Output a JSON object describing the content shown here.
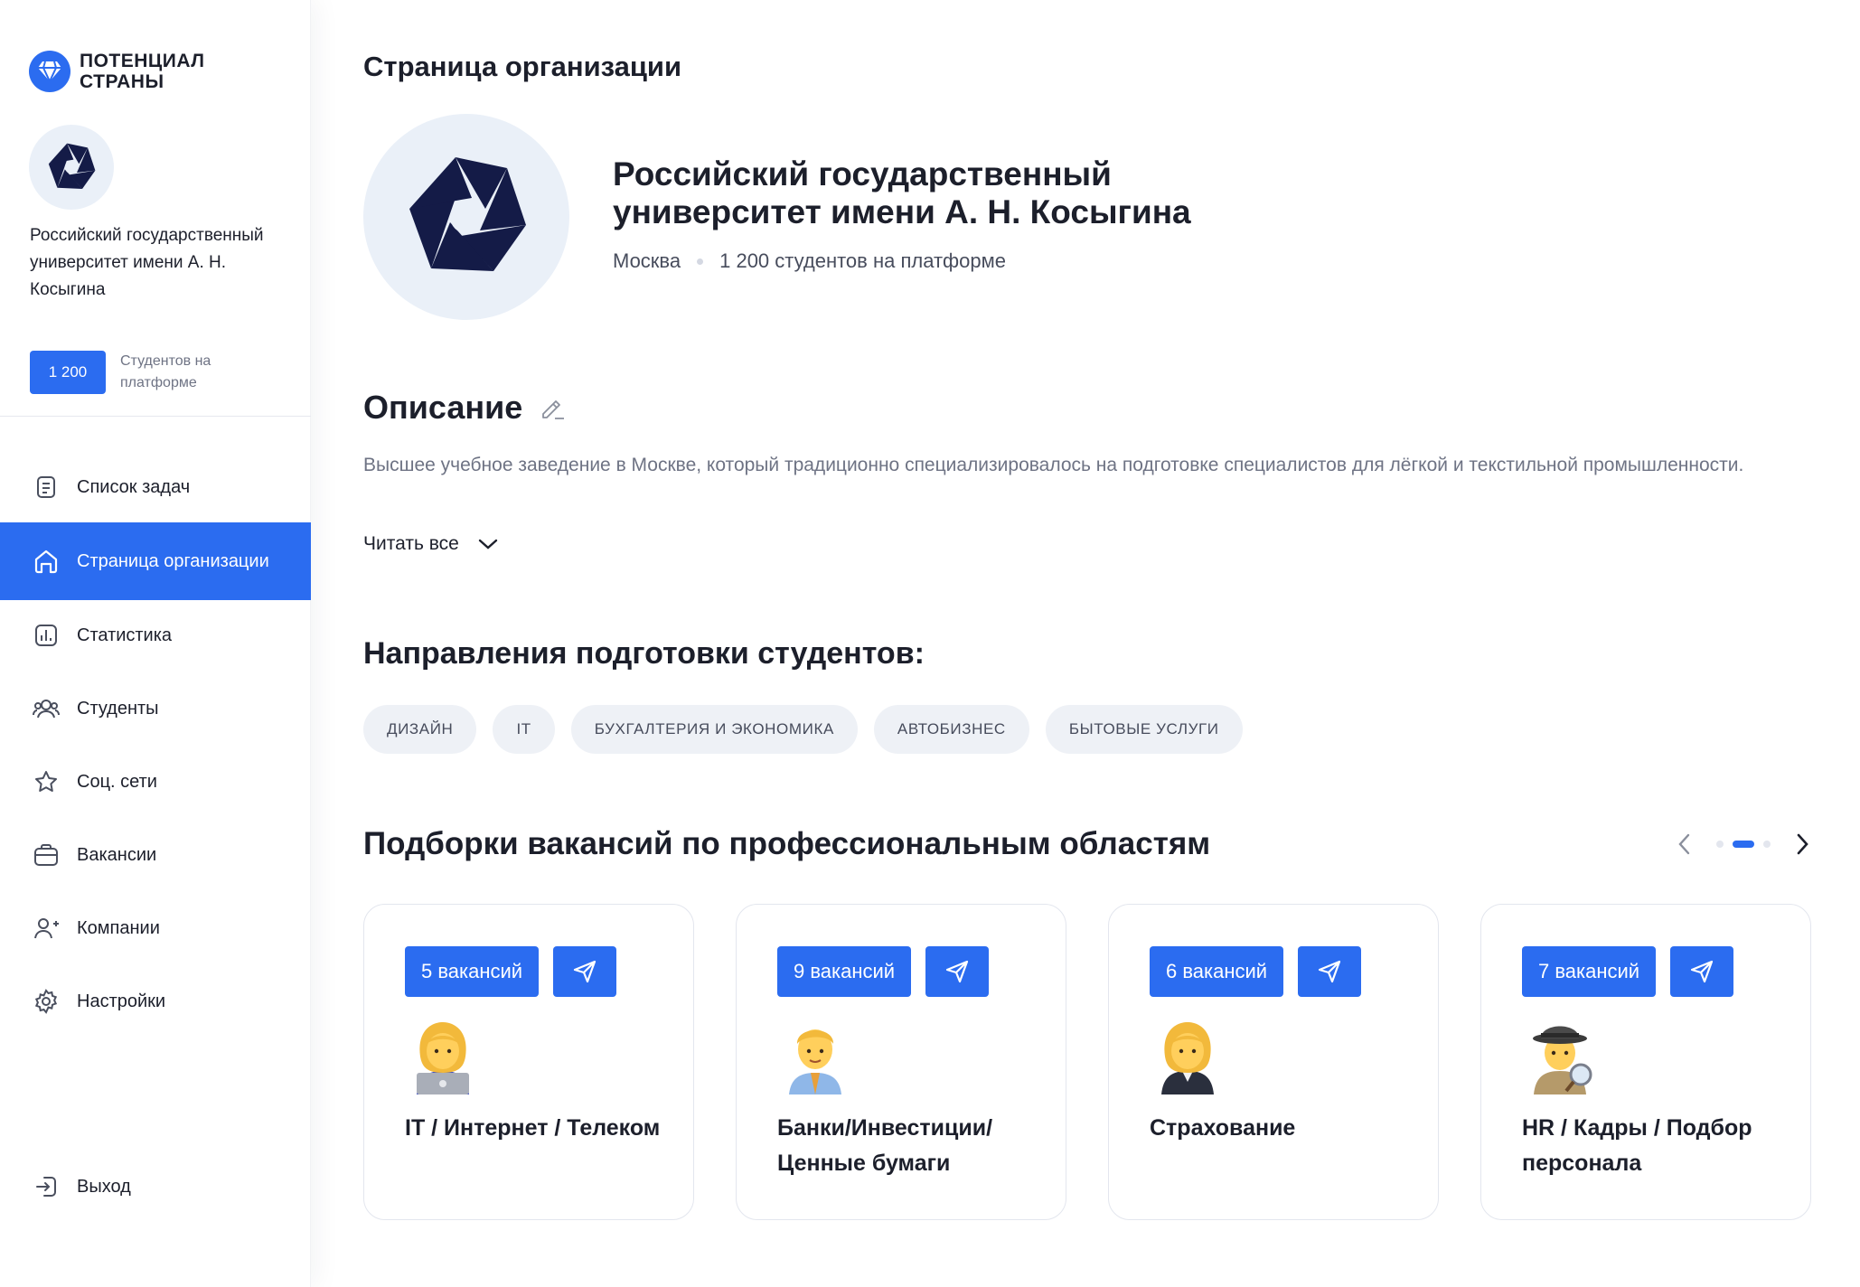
{
  "brand": {
    "name": "ПОТЕНЦИАЛ СТРАНЫ",
    "color": "#2b6cf0"
  },
  "sidebar": {
    "org_name": "Российский государственный университет имени А. Н. Косыгина",
    "students_count": "1 200",
    "students_label": "Студентов на платформе",
    "items": [
      {
        "label": "Список задач",
        "icon": "task-list-icon",
        "active": false
      },
      {
        "label": "Страница организации",
        "icon": "home-icon",
        "active": true
      },
      {
        "label": "Статистика",
        "icon": "chart-icon",
        "active": false
      },
      {
        "label": "Студенты",
        "icon": "users-icon",
        "active": false
      },
      {
        "label": "Соц. сети",
        "icon": "star-icon",
        "active": false
      },
      {
        "label": "Вакансии",
        "icon": "briefcase-icon",
        "active": false
      },
      {
        "label": "Компании",
        "icon": "user-add-icon",
        "active": false
      },
      {
        "label": "Настройки",
        "icon": "gear-icon",
        "active": false
      }
    ],
    "logout_label": "Выход"
  },
  "main": {
    "page_title": "Страница организации",
    "org": {
      "name": "Российский государственный университет имени А. Н. Косыгина",
      "city": "Москва",
      "students": "1 200 студентов на платформе"
    },
    "description": {
      "title": "Описание",
      "text": "Высшее учебное заведение в Москве, который традиционно специализировалось на подготовке специалистов для лёгкой и текстильной промышленности.",
      "read_all": "Читать все"
    },
    "directions": {
      "title": "Направления подготовки студентов:",
      "tags": [
        "ДИЗАЙН",
        "IT",
        "БУХГАЛТЕРИЯ И ЭКОНОМИКА",
        "АВТОБИЗНЕС",
        "БЫТОВЫЕ УСЛУГИ"
      ]
    },
    "vacancies": {
      "title": "Подборки вакансий по профессиональным областям",
      "carousel": {
        "pages": 3,
        "current": 2
      },
      "cards": [
        {
          "count": "5 вакансий",
          "emoji": "woman-technologist-icon",
          "title": "IT / Интернет / Телеком"
        },
        {
          "count": "9 вакансий",
          "emoji": "man-office-worker-icon",
          "title": "Банки/Инвестиции/ Ценные бумаги"
        },
        {
          "count": "6 вакансий",
          "emoji": "woman-office-worker-icon",
          "title": "Страхование"
        },
        {
          "count": "7 вакансий",
          "emoji": "detective-icon",
          "title": "HR / Кадры / Подбор персонала"
        }
      ]
    }
  }
}
